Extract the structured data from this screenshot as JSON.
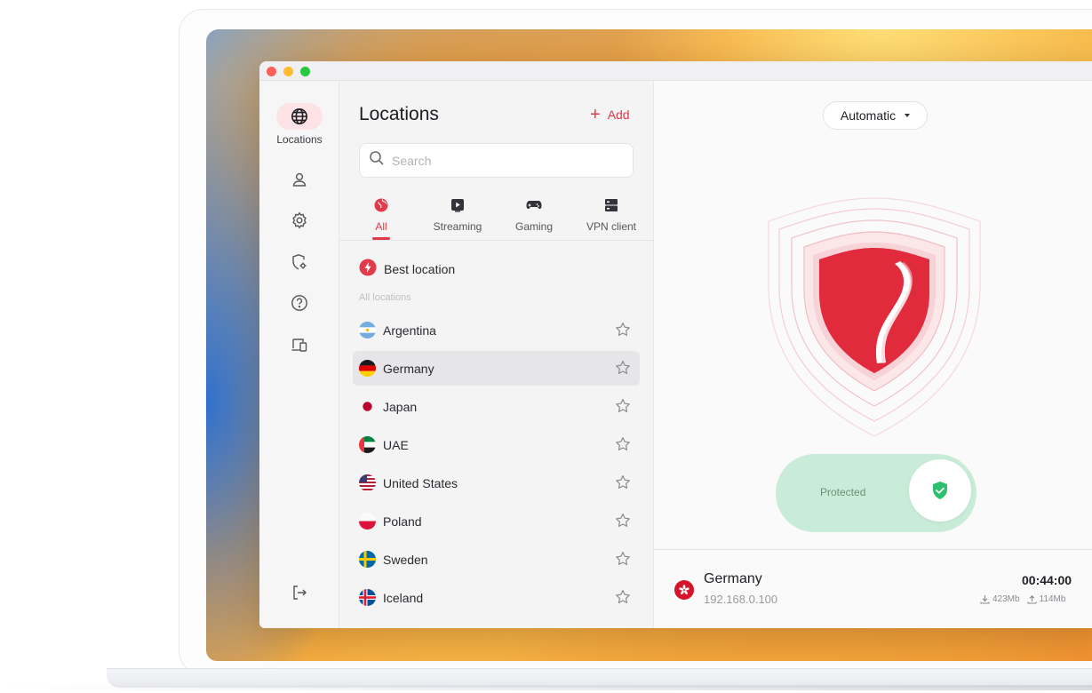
{
  "sidebar": {
    "items": [
      {
        "label": "Locations",
        "icon": "globe-icon",
        "active": true
      },
      {
        "label": "",
        "icon": "user-icon"
      },
      {
        "label": "",
        "icon": "gear-icon"
      },
      {
        "label": "",
        "icon": "shield-settings-icon"
      },
      {
        "label": "",
        "icon": "help-icon"
      },
      {
        "label": "",
        "icon": "devices-icon"
      }
    ],
    "logout_icon": "logout-icon"
  },
  "locations": {
    "title": "Locations",
    "add_label": "Add",
    "search_placeholder": "Search",
    "tabs": [
      {
        "label": "All",
        "icon": "globe-icon",
        "active": true
      },
      {
        "label": "Streaming",
        "icon": "play-icon"
      },
      {
        "label": "Gaming",
        "icon": "gamepad-icon"
      },
      {
        "label": "VPN client",
        "icon": "server-icon"
      }
    ],
    "best_location": "Best location",
    "section_label": "All locations",
    "list": [
      {
        "name": "Argentina",
        "flag": "argentina-flag",
        "selected": false
      },
      {
        "name": "Germany",
        "flag": "germany-flag",
        "selected": true
      },
      {
        "name": "Japan",
        "flag": "japan-flag",
        "selected": false
      },
      {
        "name": "UAE",
        "flag": "uae-flag",
        "selected": false
      },
      {
        "name": "United States",
        "flag": "usa-flag",
        "selected": false
      },
      {
        "name": "Poland",
        "flag": "poland-flag",
        "selected": false
      },
      {
        "name": "Sweden",
        "flag": "sweden-flag",
        "selected": false
      },
      {
        "name": "Iceland",
        "flag": "iceland-flag",
        "selected": false
      }
    ]
  },
  "main": {
    "mode_select": "Automatic",
    "toggle_label": "Protected",
    "status": {
      "country": "Germany",
      "ip": "192.168.0.100",
      "timer": "00:44:00",
      "download": "423Mb",
      "upload": "114Mb"
    }
  },
  "colors": {
    "accent": "#e23a48",
    "protected_bg": "#c8ecd7",
    "protected_icon": "#2bbf6e"
  }
}
